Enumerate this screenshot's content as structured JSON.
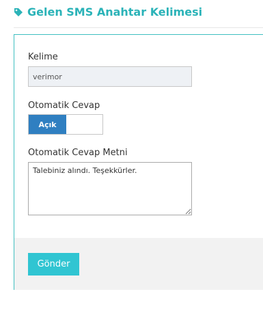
{
  "header": {
    "title": "Gelen SMS Anahtar Kelimesi",
    "icon": "tag-icon",
    "accent_color": "#2bb3b8"
  },
  "form": {
    "keyword": {
      "label": "Kelime",
      "value": "verimor"
    },
    "auto_reply": {
      "label": "Otomatik Cevap",
      "state_label": "Açık",
      "on_color": "#2f7fc1"
    },
    "auto_reply_text": {
      "label": "Otomatik Cevap Metni",
      "value": "Talebiniz alındı. Teşekkürler."
    }
  },
  "footer": {
    "submit_label": "Gönder",
    "submit_color": "#30c5d2"
  }
}
